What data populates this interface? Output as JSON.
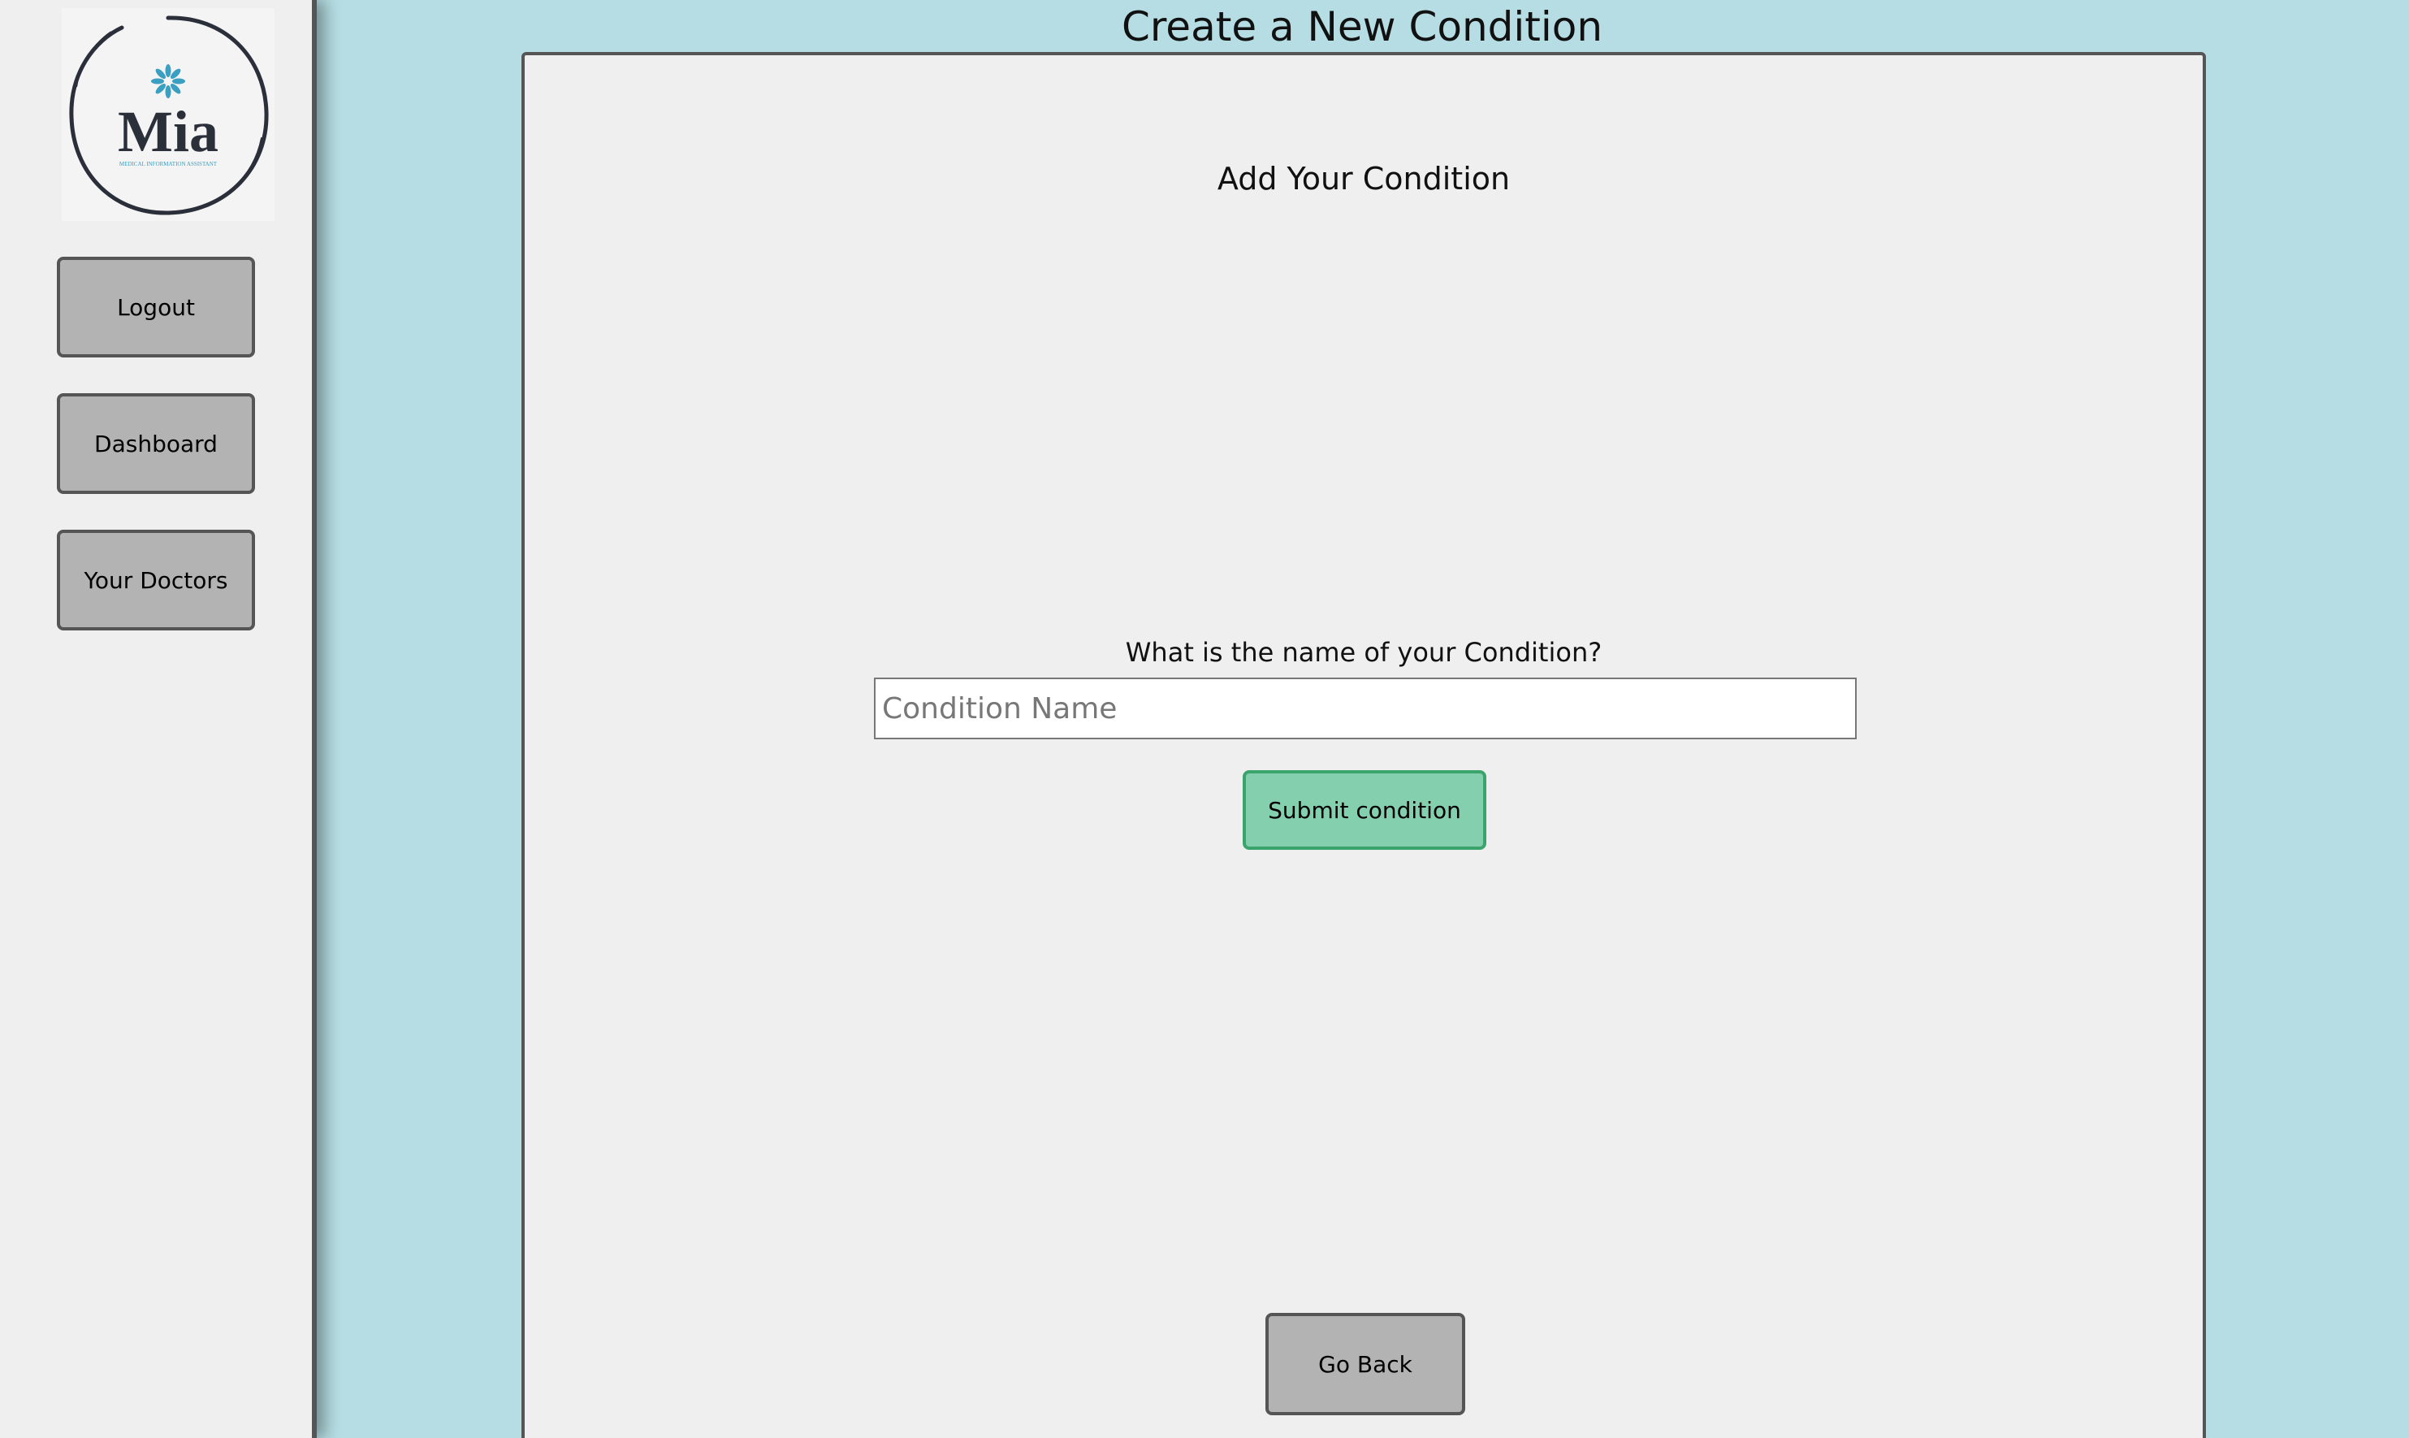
{
  "sidebar": {
    "logo": {
      "icon": "flower-icon",
      "name": "Mia",
      "tagline": "MEDICAL INFORMATION ASSISTANT",
      "accent_color": "#3a9fc0",
      "text_color": "#2a2f3a"
    },
    "buttons": {
      "logout": "Logout",
      "dashboard": "Dashboard",
      "doctors": "Your Doctors"
    }
  },
  "header": {
    "title": "Create a New Condition"
  },
  "main": {
    "heading": "Add Your Condition",
    "field_label": "What is the name of your Condition?",
    "input_placeholder": "Condition Name",
    "input_value": "",
    "submit_label": "Submit condition",
    "back_label": "Go Back"
  },
  "colors": {
    "background": "#b5dde3",
    "panel": "#efefef",
    "button_gray": "#b3b3b3",
    "submit_green": "#84cfad",
    "submit_border": "#3aa46c"
  }
}
